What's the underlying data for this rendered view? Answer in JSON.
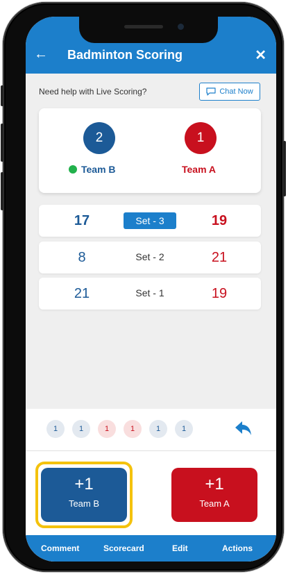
{
  "app_bar": {
    "back_icon": "arrow-left",
    "title": "Badminton Scoring",
    "close_icon": "close-x",
    "color": "#1c7fcb"
  },
  "help": {
    "question": "Need help with Live Scoring?",
    "chat_label": "Chat Now",
    "chat_icon": "chat-bubble"
  },
  "match": {
    "team_b": {
      "name": "Team B",
      "sets_won": "2",
      "color": "#1c5a97",
      "serving": true
    },
    "team_a": {
      "name": "Team A",
      "sets_won": "1",
      "color": "#c8101e"
    }
  },
  "sets": [
    {
      "label": "Set - 3",
      "team_b": "17",
      "team_a": "19",
      "active": true
    },
    {
      "label": "Set - 2",
      "team_b": "8",
      "team_a": "21",
      "active": false
    },
    {
      "label": "Set - 1",
      "team_b": "21",
      "team_a": "19",
      "active": false
    }
  ],
  "point_history": [
    {
      "value": "1",
      "team": "B"
    },
    {
      "value": "1",
      "team": "B"
    },
    {
      "value": "1",
      "team": "A"
    },
    {
      "value": "1",
      "team": "A"
    },
    {
      "value": "1",
      "team": "B"
    },
    {
      "value": "1",
      "team": "B"
    }
  ],
  "undo_icon": "undo-arrow",
  "buttons": {
    "team_b": {
      "plus": "+1",
      "label": "Team B"
    },
    "team_a": {
      "plus": "+1",
      "label": "Team A"
    }
  },
  "bottom_nav": {
    "comment": "Comment",
    "scorecard": "Scorecard",
    "edit": "Edit",
    "actions": "Actions"
  },
  "colors": {
    "highlight": "#f4c20d",
    "serving_dot": "#22b14c"
  }
}
